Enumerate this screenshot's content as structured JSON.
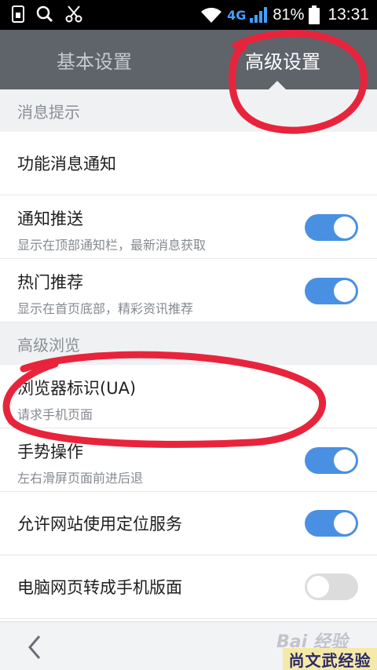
{
  "status_bar": {
    "signal_label": "4G",
    "battery": "81%",
    "time": "13:31",
    "icons": [
      "sim-icon",
      "search-icon",
      "scissors-icon",
      "wifi-icon",
      "signal-icon",
      "battery-icon"
    ]
  },
  "tabs": {
    "basic": "基本设置",
    "advanced": "高级设置",
    "active": "advanced"
  },
  "sections": {
    "notifications": {
      "header": "消息提示",
      "feature_notice": "功能消息通知",
      "push_title": "通知推送",
      "push_sub": "显示在顶部通知栏，最新消息获取",
      "push_on": true,
      "hot_title": "热门推荐",
      "hot_sub": "显示在首页底部，精彩资讯推荐",
      "hot_on": true
    },
    "browsing": {
      "header": "高级浏览",
      "ua_title": "浏览器标识(UA)",
      "ua_sub": "请求手机页面",
      "gesture_title": "手势操作",
      "gesture_sub": "左右滑屏页面前进后退",
      "gesture_on": true,
      "location_title": "允许网站使用定位服务",
      "location_on": true,
      "desktop_title": "电脑网页转成手机版面",
      "desktop_on": false
    }
  },
  "colors": {
    "toggle_on": "#4a90e2",
    "tab_bar": "#5f646b",
    "annotation": "#e8243c"
  },
  "watermark": {
    "baidu": "Bai 经验",
    "stamp": "尚文武经验"
  }
}
